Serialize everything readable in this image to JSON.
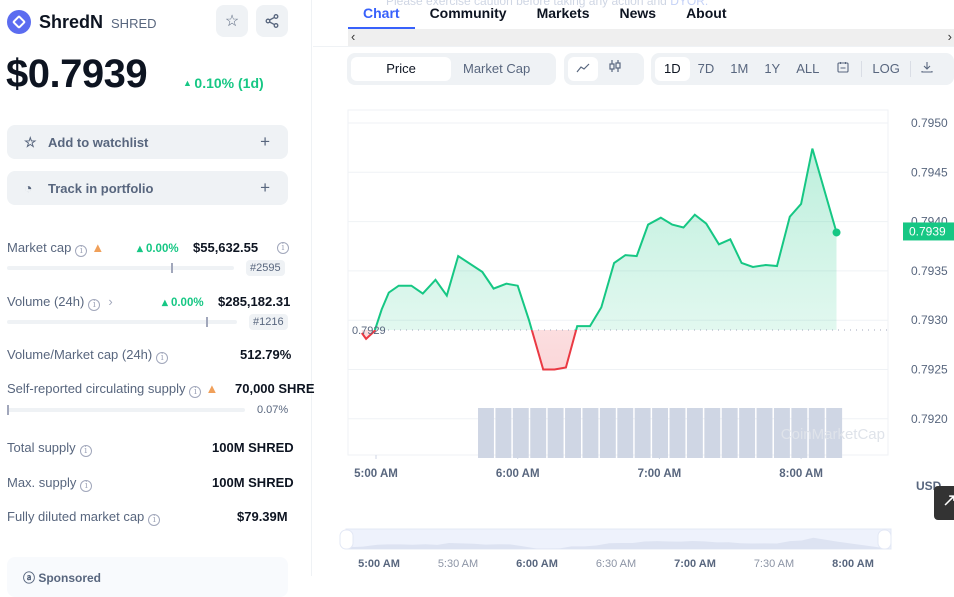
{
  "coin": {
    "name": "ShredN",
    "symbol": "SHRED",
    "price": "$0.7939",
    "change": "0.10% (1d)"
  },
  "header_buttons": [
    {
      "name": "star-icon",
      "glyph": "☆"
    },
    {
      "name": "share-icon",
      "glyph": "<"
    }
  ],
  "actions": {
    "watchlist": "Add to watchlist",
    "portfolio": "Track in portfolio"
  },
  "stats": {
    "market_cap": {
      "label": "Market cap",
      "change": "0.00%",
      "value": "$55,632.55",
      "rank": "#2595"
    },
    "volume": {
      "label": "Volume (24h)",
      "change": "0.00%",
      "value": "$285,182.31",
      "rank": "#1216"
    },
    "vol_mcap": {
      "label": "Volume/Market cap (24h)",
      "value": "512.79%"
    },
    "circ_supply": {
      "label": "Self-reported circulating supply",
      "value": "70,000 SHRE",
      "pct": "0.07%"
    },
    "total_supply": {
      "label": "Total supply",
      "value": "100M SHRED"
    },
    "max_supply": {
      "label": "Max. supply",
      "value": "100M SHRED"
    },
    "fdmc": {
      "label": "Fully diluted market cap",
      "value": "$79.39M"
    }
  },
  "sponsored": "Sponsored",
  "notice": {
    "text": "Please exercise caution before taking any action and ",
    "link": "DYOR."
  },
  "tabs": [
    "Chart",
    "Community",
    "Markets",
    "News",
    "About"
  ],
  "chart_controls": {
    "type_options": [
      "Price",
      "Market Cap"
    ],
    "ranges": [
      "1D",
      "7D",
      "1M",
      "1Y",
      "ALL"
    ],
    "log": "LOG"
  },
  "currency": "USD",
  "colors": {
    "up": "#16c784",
    "down": "#ea3943",
    "accent": "#3861fb"
  },
  "chart_data": {
    "type": "line",
    "title": "",
    "xlabel": "",
    "ylabel": "USD",
    "x_ticks": [
      "5:00 AM",
      "6:00 AM",
      "7:00 AM",
      "8:00 AM"
    ],
    "x_tick_hours": [
      5,
      6,
      7,
      8
    ],
    "nav_ticks": [
      "5:00 AM",
      "5:30 AM",
      "6:00 AM",
      "6:30 AM",
      "7:00 AM",
      "7:30 AM",
      "8:00 AM"
    ],
    "y_ticks": [
      "0.7950",
      "0.7945",
      "0.7940",
      "0.7935",
      "0.7930",
      "0.7925",
      "0.7920"
    ],
    "ylim": [
      0.79185,
      0.7952
    ],
    "xlim_hours": [
      4.9,
      8.6
    ],
    "baseline": 0.7929,
    "baseline_label": "0.7929",
    "current_price_label": "0.7939",
    "current_price": 0.7939,
    "watermark": "CoinMarketCap",
    "x_hours": [
      4.9,
      4.93,
      4.99,
      5.04,
      5.09,
      5.16,
      5.25,
      5.33,
      5.42,
      5.5,
      5.58,
      5.75,
      5.83,
      5.92,
      6.0,
      6.08,
      6.18,
      6.26,
      6.34,
      6.42,
      6.51,
      6.59,
      6.68,
      6.76,
      6.84,
      6.92,
      7.01,
      7.09,
      7.17,
      7.25,
      7.33,
      7.42,
      7.5,
      7.58,
      7.66,
      7.75,
      7.83,
      7.92,
      8.0,
      8.08,
      8.25
    ],
    "values": [
      0.79287,
      0.79281,
      0.79289,
      0.79311,
      0.79328,
      0.79335,
      0.79335,
      0.79327,
      0.79341,
      0.79325,
      0.79365,
      0.79349,
      0.79332,
      0.79337,
      0.79335,
      0.793,
      0.7925,
      0.7925,
      0.79252,
      0.79294,
      0.79294,
      0.79313,
      0.79358,
      0.79366,
      0.79365,
      0.79397,
      0.79404,
      0.79397,
      0.79394,
      0.79407,
      0.79398,
      0.79377,
      0.79382,
      0.79358,
      0.79354,
      0.79356,
      0.79355,
      0.79405,
      0.79418,
      0.79474,
      0.79389
    ],
    "volume_bars": 21,
    "volume_start_hour": 5.72,
    "volume_end_hour": 8.3
  }
}
